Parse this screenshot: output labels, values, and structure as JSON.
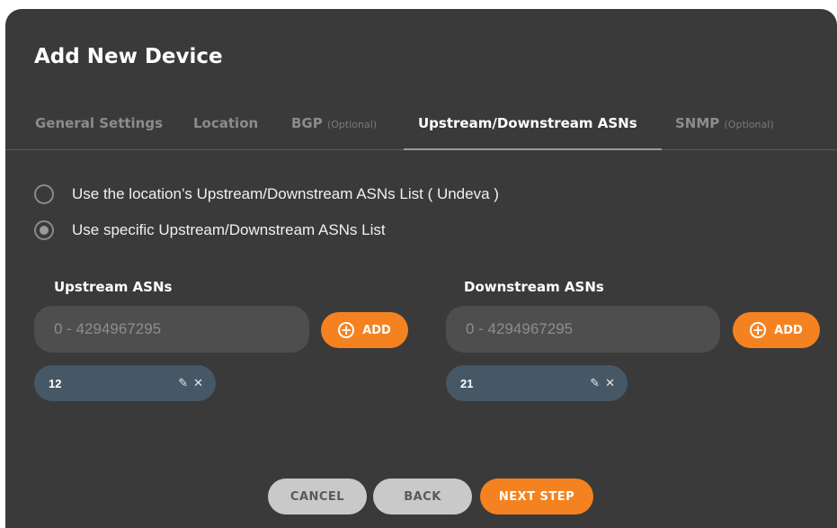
{
  "dialog": {
    "title": "Add New Device"
  },
  "tabs": [
    {
      "label": "General Settings",
      "optional": ""
    },
    {
      "label": "Location",
      "optional": ""
    },
    {
      "label": "BGP",
      "optional": "(Optional)"
    },
    {
      "label": "Upstream/Downstream ASNs",
      "optional": ""
    },
    {
      "label": "SNMP",
      "optional": "(Optional)"
    }
  ],
  "active_tab": "Upstream/Downstream ASNs",
  "options": [
    {
      "label": "Use the location’s Upstream/Downstream ASNs List ( Undeva )",
      "checked": false
    },
    {
      "label": "Use specific Upstream/Downstream ASNs List",
      "checked": true
    }
  ],
  "upstream": {
    "label": "Upstream ASNs",
    "placeholder": "0 - 4294967295",
    "add_label": "ADD",
    "chips": [
      "12"
    ]
  },
  "downstream": {
    "label": "Downstream ASNs",
    "placeholder": "0 - 4294967295",
    "add_label": "ADD",
    "chips": [
      "21"
    ]
  },
  "footer": {
    "cancel": "CANCEL",
    "back": "BACK",
    "next": "NEXT STEP"
  },
  "colors": {
    "accent": "#f58220",
    "background": "#3a3a3a",
    "chip": "#465766"
  }
}
